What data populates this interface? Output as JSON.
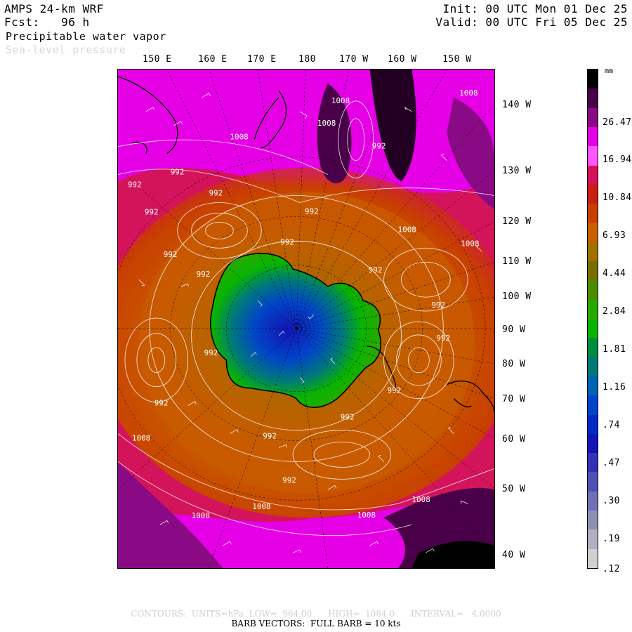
{
  "header": {
    "model": "AMPS 24-km WRF",
    "forecast": "Fcst:   96 h",
    "init": "Init: 00 UTC Mon 01 Dec 25",
    "valid": "Valid: 00 UTC Fri 05 Dec 25",
    "field1": "Precipitable water vapor",
    "field2": "Sea-level pressure"
  },
  "longitude_labels": [
    "150 E",
    "160 E",
    "170 E",
    "180",
    "170 W",
    "160 W",
    "150 W"
  ],
  "right_labels": [
    "140 W",
    "130 W",
    "120 W",
    "110 W",
    "100 W",
    "90 W",
    "80 W",
    "70 W",
    "60 W",
    "50 W",
    "40 W"
  ],
  "pressure_labels": [
    "1008",
    "1008",
    "1008",
    "1008",
    "992",
    "992",
    "992",
    "992",
    "1008",
    "1008",
    "992",
    "992",
    "992",
    "992",
    "992",
    "992",
    "992",
    "992",
    "992",
    "992",
    "992",
    "1008",
    "1008",
    "1008",
    "1008",
    "1008",
    "992",
    "992",
    "992"
  ],
  "colorbar": {
    "unit": "mm",
    "labels": [
      "26.47",
      "16.94",
      "10.84",
      "6.93",
      "4.44",
      "2.84",
      "1.81",
      "1.16",
      ".74",
      ".47",
      ".30",
      ".19",
      ".12"
    ],
    "colors": [
      "#000000",
      "#4a0048",
      "#8a0a86",
      "#e600e6",
      "#ff55ff",
      "#d4145a",
      "#c82010",
      "#c84000",
      "#c86000",
      "#a07000",
      "#786e00",
      "#4a8c00",
      "#2aa800",
      "#08b400",
      "#008c3c",
      "#007a78",
      "#0064b4",
      "#0046c8",
      "#0028c8",
      "#1414b4",
      "#3232b4",
      "#5050b4",
      "#7070b4",
      "#9090b4",
      "#b0b0c0",
      "#d0d0d0"
    ]
  },
  "footer": {
    "contours": "CONTOURS:  UNITS=hPa  LOW=  964.00      HIGH=  1084.0      INTERVAL=   4.0000",
    "barbs": "BARB VECTORS:  FULL BARB = 10 kts"
  }
}
